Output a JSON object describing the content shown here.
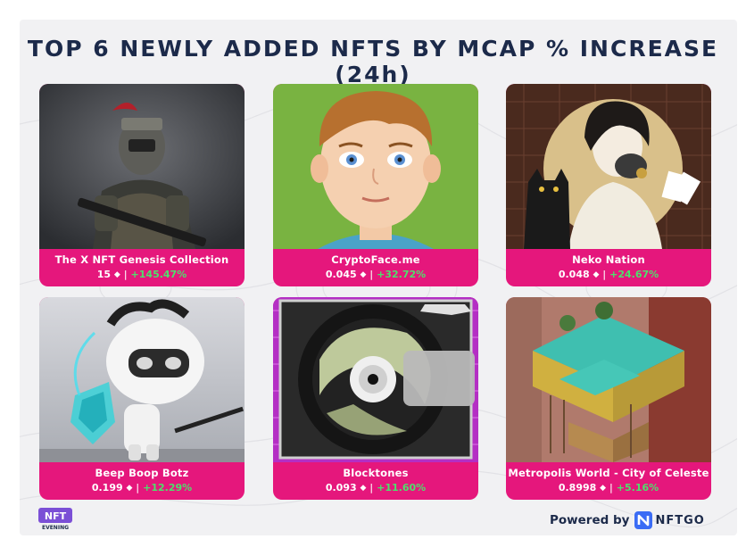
{
  "header": {
    "title": "TOP 6 NEWLY ADDED NFTS BY MCAP % INCREASE (24h)"
  },
  "colors": {
    "title": "#1c2a4a",
    "tile_label_bg": "#e5177c",
    "increase": "#4ee06c",
    "background": "#f1f1f3"
  },
  "collections": [
    {
      "name": "The X NFT Genesis Collection",
      "price": "15",
      "change": "+145.47%",
      "image": "armored-soldier-art"
    },
    {
      "name": "CryptoFace.me",
      "price": "0.045",
      "change": "+32.72%",
      "image": "cartoon-boy-face-art"
    },
    {
      "name": "Neko Nation",
      "price": "0.048",
      "change": "+24.67%",
      "image": "masked-figure-with-cat-art"
    },
    {
      "name": "Beep Boop Botz",
      "price": "0.199",
      "change": "+12.29%",
      "image": "robot-with-shield-art"
    },
    {
      "name": "Blocktones",
      "price": "0.093",
      "change": "+11.60%",
      "image": "vinyl-disc-art"
    },
    {
      "name": "Metropolis World - City of Celeste",
      "price": "0.8998",
      "change": "+5.16%",
      "image": "isometric-building-art"
    }
  ],
  "footer": {
    "brand_logo_text": "NFT EVENING",
    "powered_by": "Powered by",
    "partner": "NFTGO"
  }
}
